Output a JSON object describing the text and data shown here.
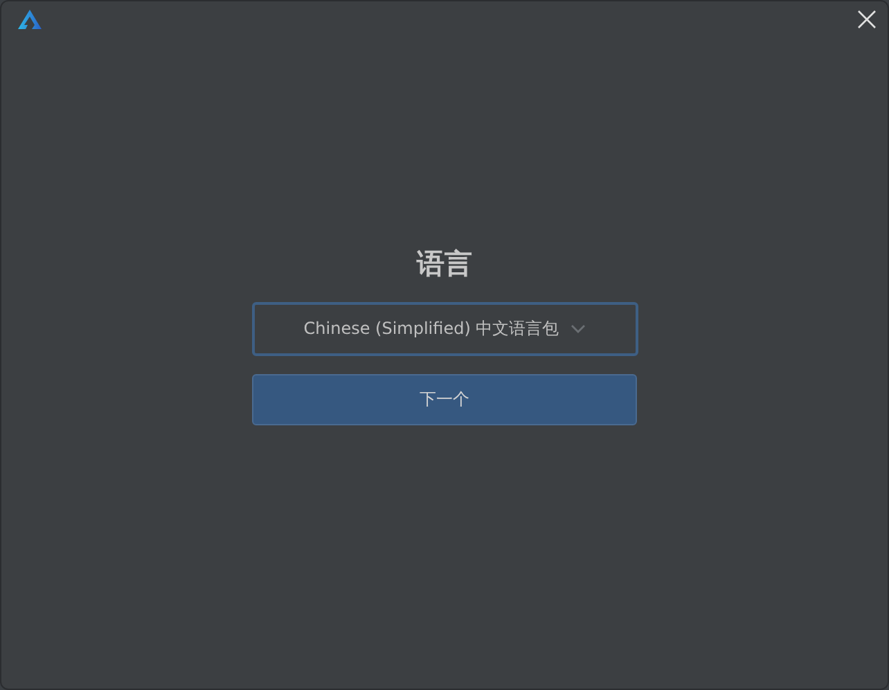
{
  "heading": "语言",
  "language_select": {
    "value": "Chinese (Simplified) 中文语言包"
  },
  "next_button": {
    "label": "下一个"
  }
}
